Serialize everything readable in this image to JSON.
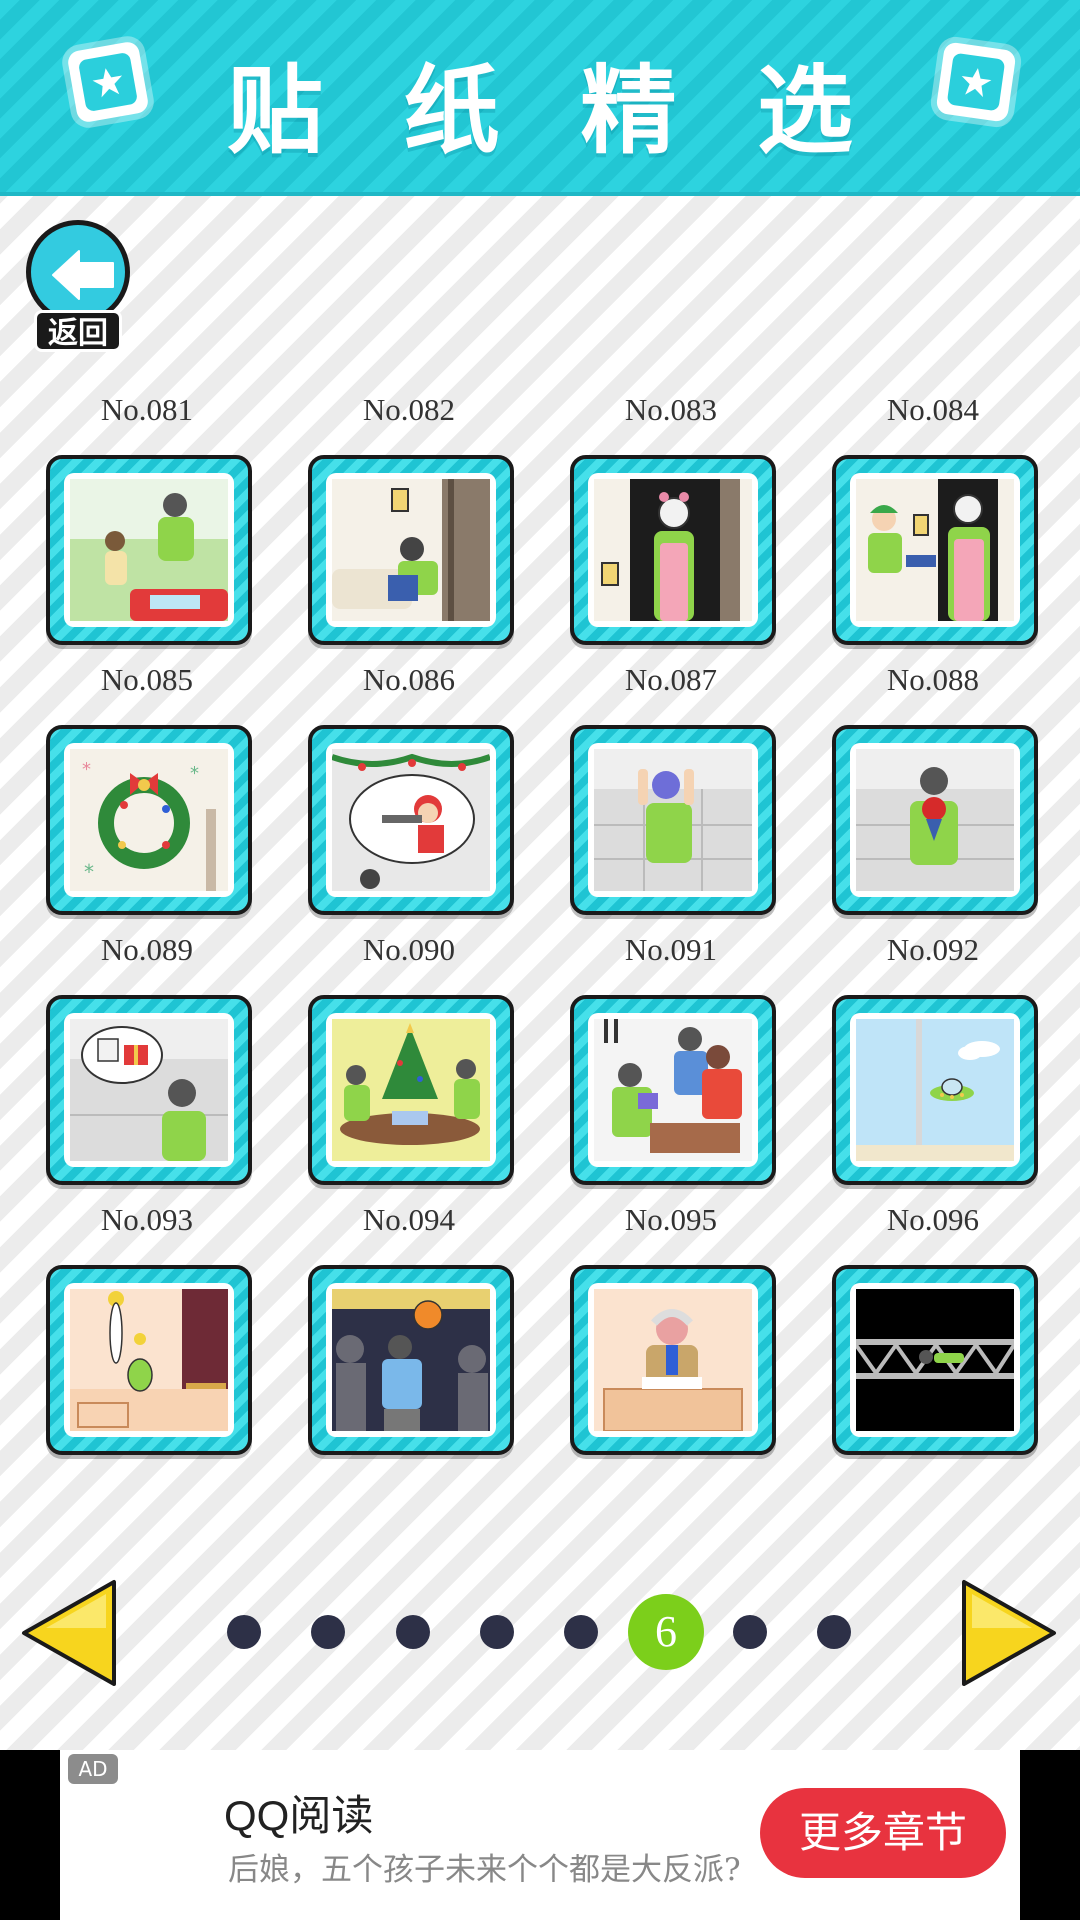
{
  "header": {
    "title_chars": [
      "贴",
      "纸",
      "精",
      "选"
    ]
  },
  "back": {
    "label": "返回"
  },
  "stickers": [
    {
      "label": "No.081"
    },
    {
      "label": "No.082"
    },
    {
      "label": "No.083"
    },
    {
      "label": "No.084"
    },
    {
      "label": "No.085"
    },
    {
      "label": "No.086"
    },
    {
      "label": "No.087"
    },
    {
      "label": "No.088"
    },
    {
      "label": "No.089"
    },
    {
      "label": "No.090"
    },
    {
      "label": "No.091"
    },
    {
      "label": "No.092"
    },
    {
      "label": "No.093"
    },
    {
      "label": "No.094"
    },
    {
      "label": "No.095"
    },
    {
      "label": "No.096"
    }
  ],
  "pager": {
    "current_page": "6",
    "total_pages": 8
  },
  "ad": {
    "badge": "AD",
    "title": "QQ阅读",
    "description": "后娘，五个孩子未来个个都是大反派?",
    "button_label": "更多章节"
  },
  "colors": {
    "header": "#29d0dc",
    "card_frame": "#2ed3e0",
    "current_page": "#7ccf1b",
    "page_dot": "#2d3047",
    "arrow": "#f7d51e",
    "ad_button": "#e8333f"
  }
}
